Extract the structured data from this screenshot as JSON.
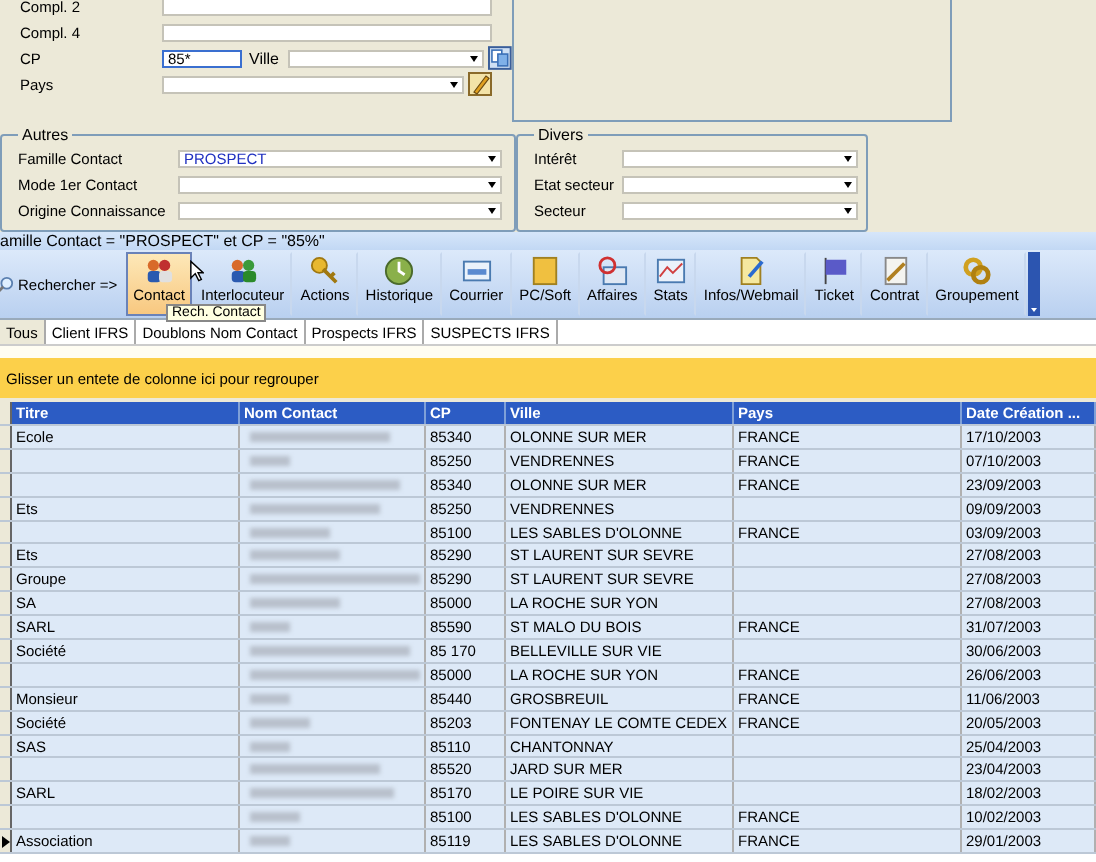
{
  "address_panel": {
    "fields": [
      {
        "label": "Compl. 2",
        "kind": "text"
      },
      {
        "label": "Compl. 4",
        "kind": "text"
      },
      {
        "label": "CP",
        "value": "85*",
        "kind": "cp",
        "extra_label": "Ville"
      },
      {
        "label": "Pays",
        "kind": "combo-edit"
      }
    ]
  },
  "autres": {
    "title": "Autres",
    "fields": [
      {
        "label": "Famille Contact",
        "value": "PROSPECT"
      },
      {
        "label": "Mode 1er Contact"
      },
      {
        "label": "Origine Connaissance"
      }
    ]
  },
  "divers": {
    "title": "Divers",
    "fields": [
      {
        "label": "Intérêt"
      },
      {
        "label": "Etat secteur"
      },
      {
        "label": "Secteur"
      }
    ]
  },
  "filter_bar": "amille Contact = \"PROSPECT\" et CP = \"85%\"",
  "toolbar": {
    "search_label": "Rechercher =>",
    "buttons": [
      {
        "label": "Contact",
        "selected": true
      },
      {
        "label": "Interlocuteur",
        "selected": false
      },
      {
        "label": "Actions",
        "selected": false
      },
      {
        "label": "Historique",
        "selected": false
      },
      {
        "label": "Courrier",
        "selected": false
      },
      {
        "label": "PC/Soft",
        "selected": false
      },
      {
        "label": "Affaires",
        "selected": false
      },
      {
        "label": "Stats",
        "selected": false
      },
      {
        "label": "Infos/Webmail",
        "selected": false
      },
      {
        "label": "Ticket",
        "selected": false
      },
      {
        "label": "Contrat",
        "selected": false
      },
      {
        "label": "Groupement",
        "selected": false
      }
    ],
    "tooltip": "Rech. Contact"
  },
  "tabs": [
    {
      "label": "Tous",
      "selected": true
    },
    {
      "label": "Client IFRS",
      "selected": false
    },
    {
      "label": "Doublons Nom Contact",
      "selected": false
    },
    {
      "label": "Prospects IFRS",
      "selected": false
    },
    {
      "label": "SUSPECTS IFRS",
      "selected": false
    }
  ],
  "group_band": "Glisser un entete de colonne ici pour regrouper",
  "table": {
    "columns": [
      "Titre",
      "Nom Contact",
      "CP",
      "Ville",
      "Pays",
      "Date Création ..."
    ],
    "rows": [
      {
        "titre": "Ecole",
        "cp": "85340",
        "ville": "OLONNE SUR MER",
        "pays": "FRANCE",
        "date": "17/10/2003",
        "selected": false
      },
      {
        "titre": "",
        "cp": "85250",
        "ville": "VENDRENNES",
        "pays": "FRANCE",
        "date": "07/10/2003",
        "selected": false
      },
      {
        "titre": "",
        "cp": "85340",
        "ville": "OLONNE SUR MER",
        "pays": "FRANCE",
        "date": "23/09/2003",
        "selected": false
      },
      {
        "titre": "Ets",
        "cp": "85250",
        "ville": "VENDRENNES",
        "pays": "",
        "date": "09/09/2003",
        "selected": false
      },
      {
        "titre": "",
        "cp": "85100",
        "ville": "LES SABLES D'OLONNE",
        "pays": "FRANCE",
        "date": "03/09/2003",
        "selected": false
      },
      {
        "titre": "Ets",
        "cp": "85290",
        "ville": "ST LAURENT SUR SEVRE",
        "pays": "",
        "date": "27/08/2003",
        "selected": false
      },
      {
        "titre": "Groupe",
        "cp": "85290",
        "ville": "ST LAURENT SUR SEVRE",
        "pays": "",
        "date": "27/08/2003",
        "selected": false
      },
      {
        "titre": "SA",
        "cp": "85000",
        "ville": "LA ROCHE SUR YON",
        "pays": "",
        "date": "27/08/2003",
        "selected": false
      },
      {
        "titre": "SARL",
        "cp": "85590",
        "ville": "ST MALO DU BOIS",
        "pays": "FRANCE",
        "date": "31/07/2003",
        "selected": false
      },
      {
        "titre": "Société",
        "cp": "85 170",
        "ville": "BELLEVILLE SUR VIE",
        "pays": "",
        "date": "30/06/2003",
        "selected": false
      },
      {
        "titre": "",
        "cp": "85000",
        "ville": "LA ROCHE SUR YON",
        "pays": "FRANCE",
        "date": "26/06/2003",
        "selected": false
      },
      {
        "titre": "Monsieur",
        "cp": "85440",
        "ville": "GROSBREUIL",
        "pays": "FRANCE",
        "date": "11/06/2003",
        "selected": false
      },
      {
        "titre": "Société",
        "cp": "85203",
        "ville": "FONTENAY LE COMTE CEDEX",
        "pays": "FRANCE",
        "date": "20/05/2003",
        "selected": false
      },
      {
        "titre": "SAS",
        "cp": "85110",
        "ville": "CHANTONNAY",
        "pays": "",
        "date": "25/04/2003",
        "selected": false
      },
      {
        "titre": "",
        "cp": "85520",
        "ville": "JARD SUR MER",
        "pays": "",
        "date": "23/04/2003",
        "selected": false
      },
      {
        "titre": "SARL",
        "cp": "85170",
        "ville": "LE POIRE SUR VIE",
        "pays": "",
        "date": "18/02/2003",
        "selected": false
      },
      {
        "titre": "",
        "cp": "85100",
        "ville": "LES SABLES D'OLONNE",
        "pays": "FRANCE",
        "date": "10/02/2003",
        "selected": false
      },
      {
        "titre": "Association",
        "cp": "85119",
        "ville": "LES SABLES D'OLONNE",
        "pays": "FRANCE",
        "date": "29/01/2003",
        "selected": true
      }
    ]
  }
}
